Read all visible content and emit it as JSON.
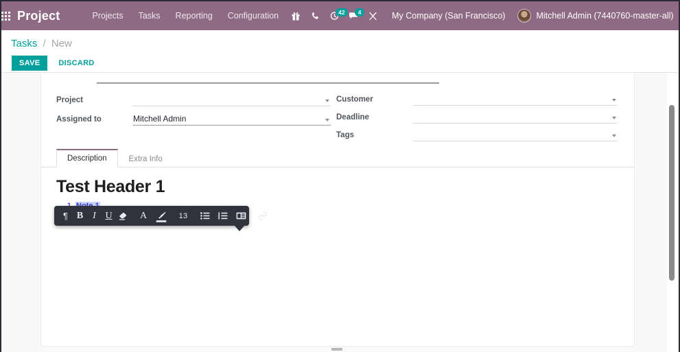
{
  "navbar": {
    "apps_icon": "grid-apps-icon",
    "brand": "Project",
    "menu": [
      {
        "label": "Projects"
      },
      {
        "label": "Tasks"
      },
      {
        "label": "Reporting"
      },
      {
        "label": "Configuration"
      }
    ],
    "icons": [
      {
        "name": "gift-icon",
        "badge": ""
      },
      {
        "name": "phone-icon",
        "badge": ""
      },
      {
        "name": "activity-clock-icon",
        "badge": "42"
      },
      {
        "name": "messages-chat-icon",
        "badge": "4"
      },
      {
        "name": "debug-wrench-icon",
        "badge": ""
      }
    ],
    "company": "My Company (San Francisco)",
    "user": "Mitchell Admin (7440760-master-all)",
    "accent": "#8f6a84",
    "badge_color": "#00a09d"
  },
  "control_panel": {
    "breadcrumb_root": "Tasks",
    "breadcrumb_sep": "/",
    "breadcrumb_current": "New",
    "save_label": "SAVE",
    "discard_label": "DISCARD",
    "primary_color": "#00a09d"
  },
  "form": {
    "left_fields": [
      {
        "label": "Project",
        "value": "",
        "caret": true
      },
      {
        "label": "Assigned to",
        "value": "Mitchell Admin",
        "caret": true
      }
    ],
    "right_fields": [
      {
        "label": "Customer",
        "value": "",
        "caret": true
      },
      {
        "label": "Deadline",
        "value": "",
        "caret": true
      },
      {
        "label": "Tags",
        "value": "",
        "caret": true
      }
    ]
  },
  "notebook": {
    "tabs": [
      {
        "label": "Description",
        "active": true
      },
      {
        "label": "Extra Info",
        "active": false
      }
    ],
    "active_tab_border": "#8f6a84"
  },
  "editor": {
    "heading": "Test Header 1",
    "list_items": [
      "Note 1"
    ]
  },
  "toolbar": {
    "buttons": [
      {
        "name": "paragraph-style-icon",
        "type": "glyph",
        "label": "¶"
      },
      {
        "name": "bold-icon",
        "type": "bold",
        "label": "B"
      },
      {
        "name": "italic-icon",
        "type": "italic",
        "label": "I"
      },
      {
        "name": "underline-icon",
        "type": "underline",
        "label": "U"
      },
      {
        "name": "remove-format-eraser-icon",
        "type": "svg-eraser",
        "label": ""
      },
      {
        "name": "font-color-icon",
        "type": "letter",
        "label": "A"
      },
      {
        "name": "highlight-brush-icon",
        "type": "svg-brush",
        "label": ""
      },
      {
        "name": "font-size-selector",
        "type": "size",
        "label": "13"
      },
      {
        "name": "unordered-list-icon",
        "type": "svg-ul",
        "label": ""
      },
      {
        "name": "ordered-list-icon",
        "type": "svg-ol",
        "label": ""
      },
      {
        "name": "media-table-icon",
        "type": "svg-media",
        "label": ""
      },
      {
        "name": "link-chain-icon",
        "type": "svg-link",
        "label": ""
      }
    ]
  }
}
